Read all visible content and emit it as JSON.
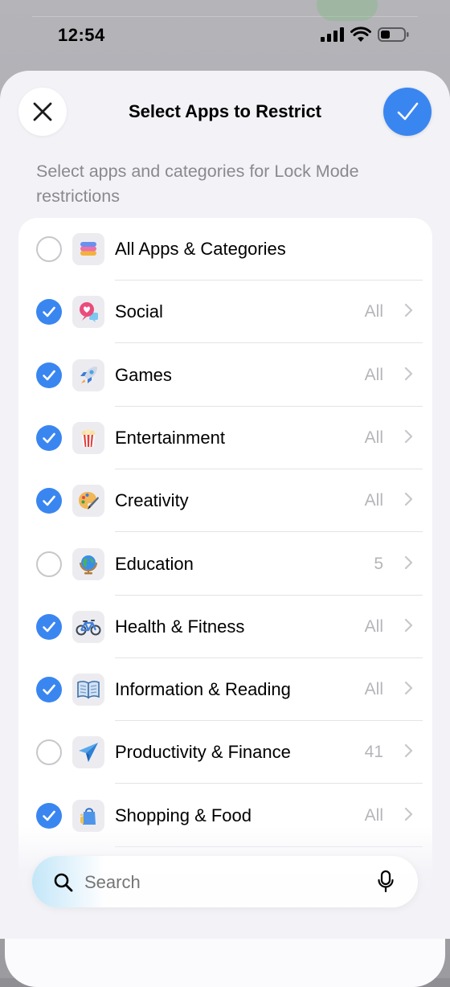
{
  "status_bar": {
    "time": "12:54"
  },
  "header": {
    "title": "Select Apps to Restrict",
    "subtitle": "Select apps and categories for Lock Mode restrictions"
  },
  "categories": [
    {
      "label": "All Apps & Categories",
      "value": "",
      "checked": false,
      "icon": "stack-layers-icon",
      "chevron": false
    },
    {
      "label": "Social",
      "value": "All",
      "checked": true,
      "icon": "speech-bubble-heart-icon",
      "chevron": true
    },
    {
      "label": "Games",
      "value": "All",
      "checked": true,
      "icon": "rocket-icon",
      "chevron": true
    },
    {
      "label": "Entertainment",
      "value": "All",
      "checked": true,
      "icon": "popcorn-icon",
      "chevron": true
    },
    {
      "label": "Creativity",
      "value": "All",
      "checked": true,
      "icon": "palette-icon",
      "chevron": true
    },
    {
      "label": "Education",
      "value": "5",
      "checked": false,
      "icon": "globe-icon",
      "chevron": true
    },
    {
      "label": "Health & Fitness",
      "value": "All",
      "checked": true,
      "icon": "bicycle-icon",
      "chevron": true
    },
    {
      "label": "Information & Reading",
      "value": "All",
      "checked": true,
      "icon": "open-book-icon",
      "chevron": true
    },
    {
      "label": "Productivity & Finance",
      "value": "41",
      "checked": false,
      "icon": "paper-plane-icon",
      "chevron": true
    },
    {
      "label": "Shopping & Food",
      "value": "All",
      "checked": true,
      "icon": "shopping-bag-icon",
      "chevron": true
    }
  ],
  "search": {
    "placeholder": "Search"
  },
  "colors": {
    "accent": "#3a86f0",
    "sheet_background": "#f2f2f7",
    "secondary_text": "#8a8a8e"
  }
}
